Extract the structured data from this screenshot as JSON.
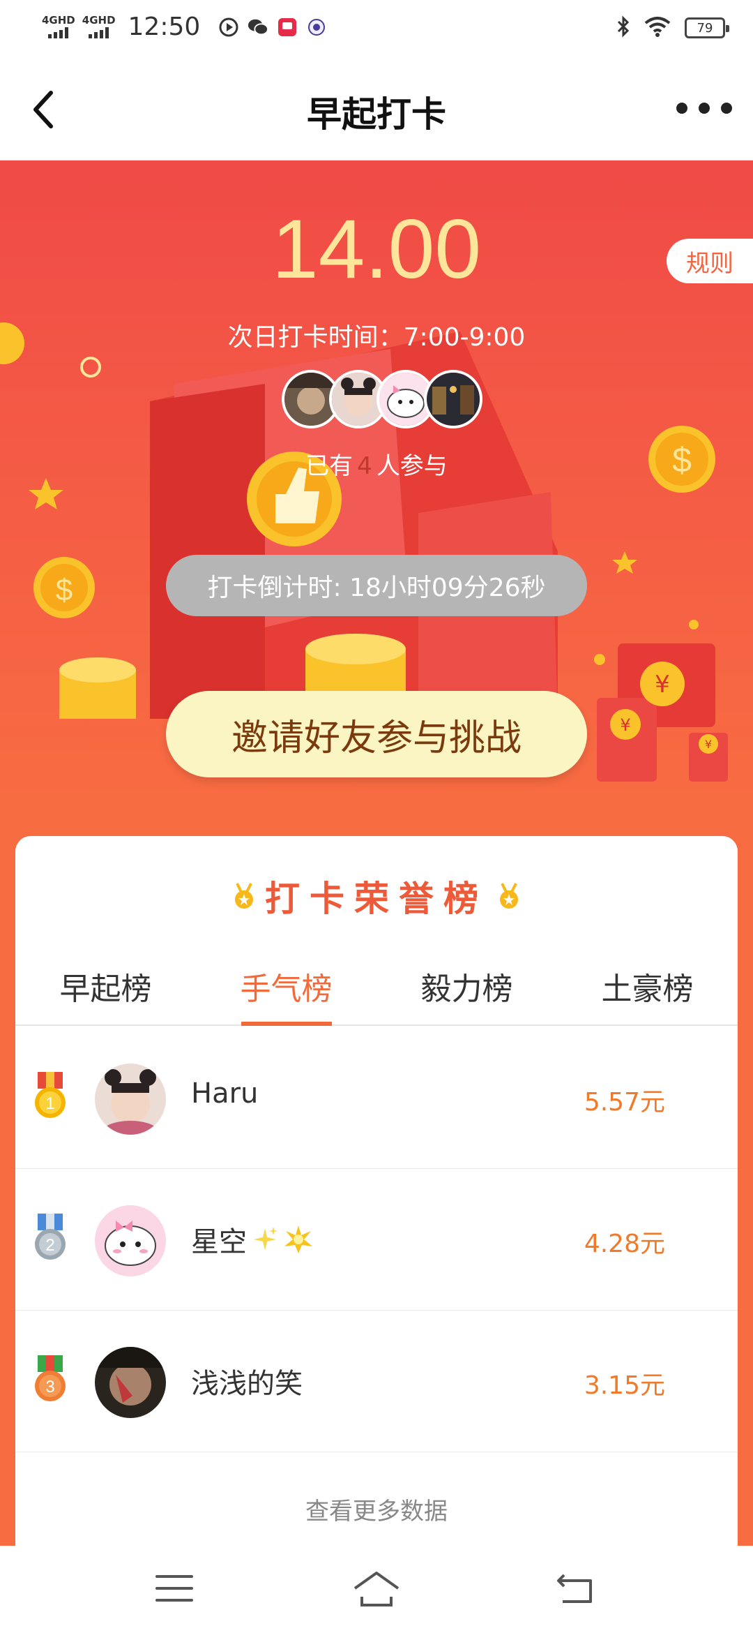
{
  "status_bar": {
    "signal_1": "4GHD",
    "signal_2": "4GHD",
    "time": "12:50",
    "battery": "79"
  },
  "nav": {
    "title": "早起打卡"
  },
  "hero": {
    "amount": "14.00",
    "rules_label": "规则",
    "next_time": "次日打卡时间：7:00-9:00",
    "participants_prefix": "已有",
    "participants_count": "4",
    "participants_suffix": "人参与",
    "countdown": "打卡倒计时: 18小时09分26秒",
    "invite_label": "邀请好友参与挑战"
  },
  "honor": {
    "title": "打卡荣誉榜",
    "tabs": [
      {
        "label": "早起榜",
        "active": false
      },
      {
        "label": "手气榜",
        "active": true
      },
      {
        "label": "毅力榜",
        "active": false
      },
      {
        "label": "土豪榜",
        "active": false
      }
    ],
    "ranks": [
      {
        "rank": "1",
        "name": "Haru",
        "amount": "5.57元",
        "medal_color": "#f5b400"
      },
      {
        "rank": "2",
        "name": "星空",
        "amount": "4.28元",
        "medal_color": "#9aa6b0"
      },
      {
        "rank": "3",
        "name": "浅浅的笑",
        "amount": "3.15元",
        "medal_color": "#ef7d33"
      }
    ],
    "more_label": "查看更多数据"
  },
  "colors": {
    "accent": "#f06a3c",
    "amount": "#fde59a",
    "hero_top": "#f04a46",
    "hero_bottom": "#f86c42"
  }
}
